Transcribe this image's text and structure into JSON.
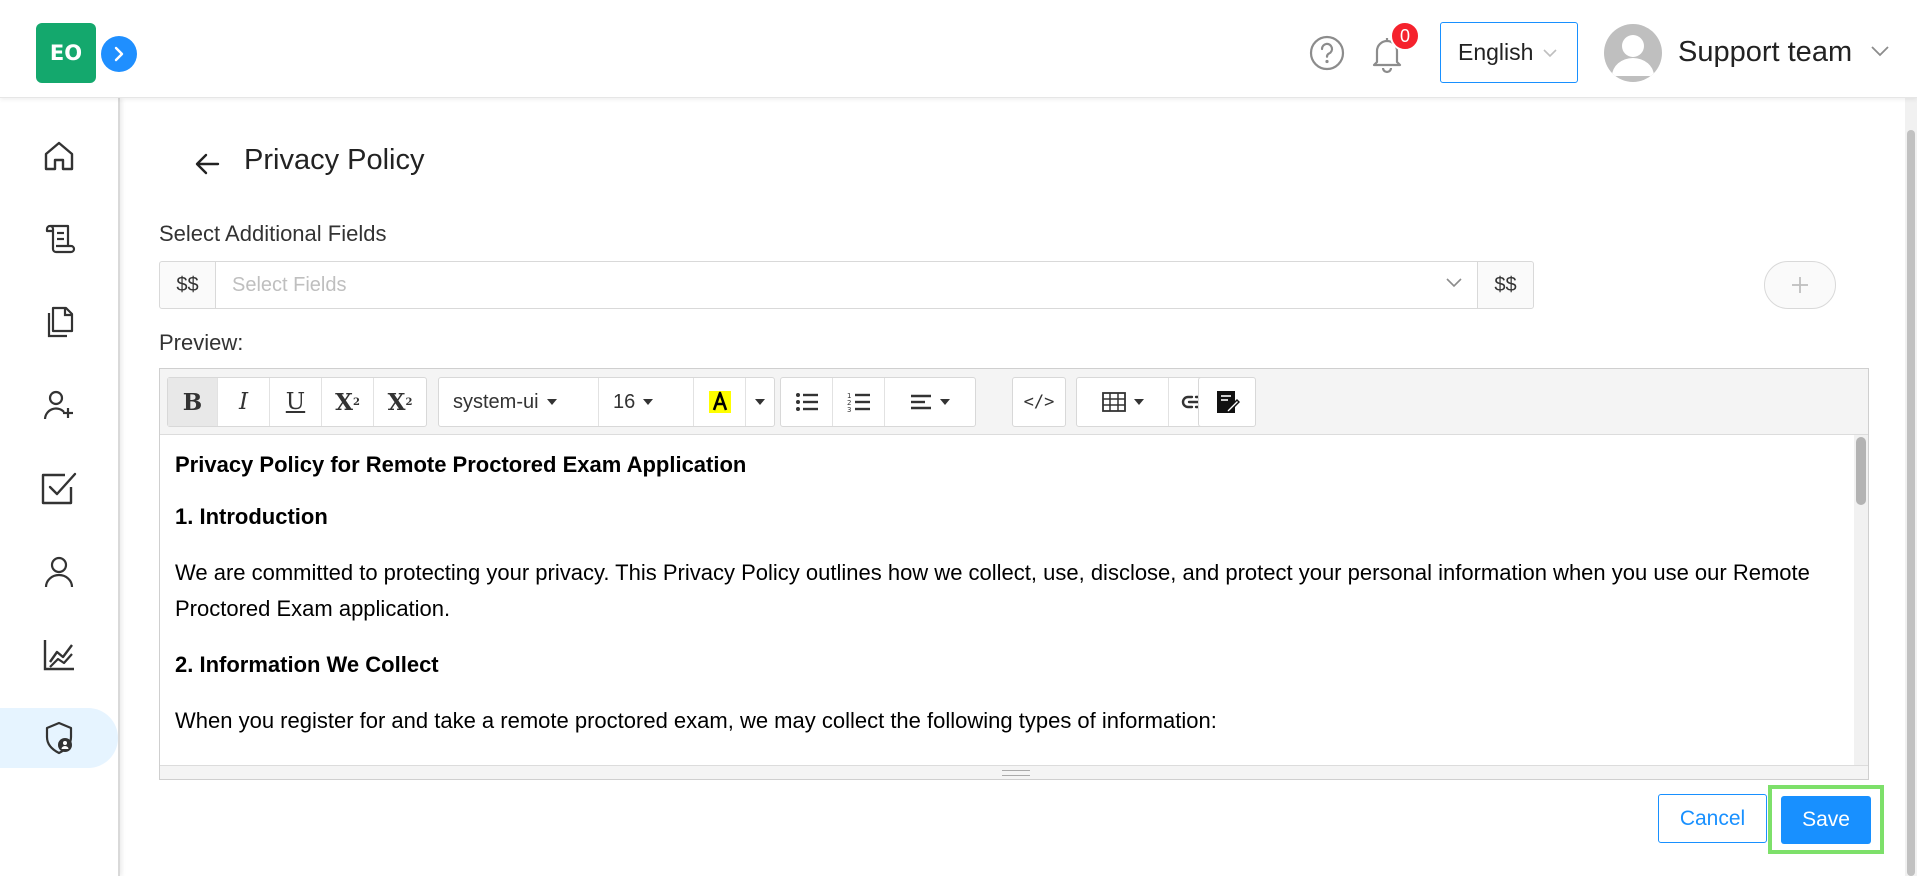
{
  "header": {
    "logo_text": "EO",
    "notification_count": "0",
    "language": "English",
    "user_name": "Support team"
  },
  "sidebar": {
    "items": [
      {
        "icon": "home-icon"
      },
      {
        "icon": "scroll-icon"
      },
      {
        "icon": "documents-icon"
      },
      {
        "icon": "add-user-icon"
      },
      {
        "icon": "checkbox-icon"
      },
      {
        "icon": "user-icon"
      },
      {
        "icon": "chart-icon"
      },
      {
        "icon": "shield-user-icon",
        "active": true
      }
    ]
  },
  "page": {
    "title": "Privacy Policy",
    "fields_label": "Select Additional Fields",
    "addon_left": "$$",
    "addon_right": "$$",
    "select_placeholder": "Select Fields",
    "preview_label": "Preview:"
  },
  "toolbar": {
    "font_family": "system-ui",
    "font_size": "16"
  },
  "content": {
    "heading": "Privacy Policy for Remote Proctored Exam Application",
    "section1_title": "1. Introduction",
    "section1_text": "We are committed to protecting your privacy. This Privacy Policy outlines how we collect, use, disclose, and protect your personal information when you use our Remote Proctored Exam application.",
    "section2_title": "2. Information We Collect",
    "section2_text": "When you register for and take a remote proctored exam, we may collect the following types of information:"
  },
  "actions": {
    "cancel_label": "Cancel",
    "save_label": "Save"
  },
  "colors": {
    "brand_green": "#14a86d",
    "primary_blue": "#1890ff",
    "badge_red": "#f5222d",
    "highlight_yellow": "#ffff00",
    "focus_green": "#7de06a"
  }
}
